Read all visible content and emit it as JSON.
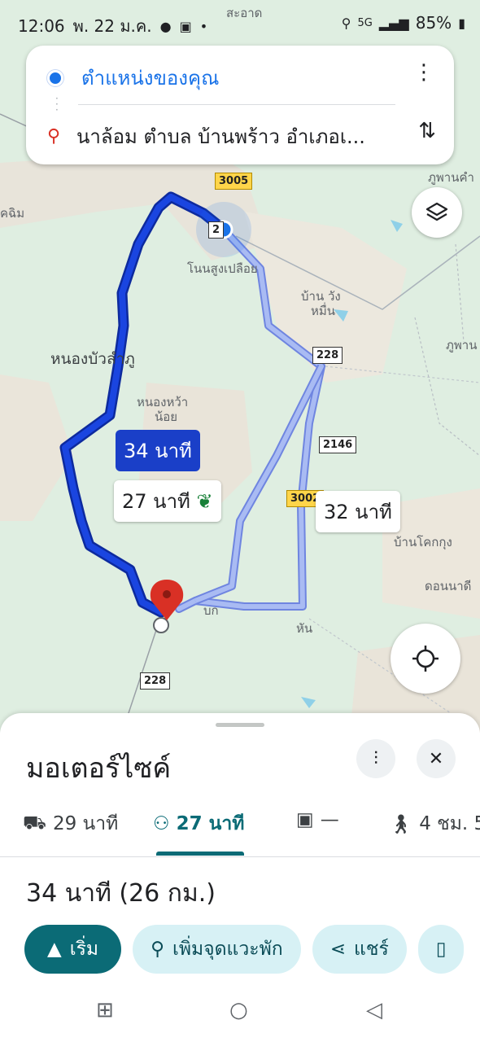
{
  "status_bar": {
    "time": "12:06",
    "date": "พ. 22 ม.ค.",
    "network": "5G",
    "battery": "85%"
  },
  "search_card": {
    "origin": "ตำแหน่งของคุณ",
    "destination": "นาล้อม ตำบล บ้านพร้าว อำเภอเ..."
  },
  "map": {
    "labels": {
      "top_center": "สะอาด",
      "top_right": "ภูพานคำ",
      "left": "คฉิม",
      "nonsung": "โนนสูงเปลือย",
      "banwang_1": "บ้าน วัง",
      "banwang_2": "หมื่น",
      "nongbua": "หนองบัวลำภู",
      "nonghwa_1": "หนองหว้า",
      "nonghwa_2": "น้อย",
      "phuphan": "ภูพาน",
      "bankhok": "บ้านโคกกุง",
      "donnadi": "ดอนนาดี",
      "bok": "บก",
      "han": "หัน"
    },
    "road_shields": {
      "r3005_top": "3005",
      "r2_top": "2",
      "r228_mid": "228",
      "r2146": "2146",
      "r3002": "3002",
      "r228_bottom": "228"
    },
    "route_times": {
      "primary": "34 นาที",
      "alt_eco": "27 นาที",
      "alt_other": "32 นาที"
    }
  },
  "sheet": {
    "title": "มอเตอร์ไซค์",
    "modes": [
      {
        "icon": "car-icon",
        "label": "29 นาที"
      },
      {
        "icon": "motorcycle-icon",
        "label": "27 นาที"
      },
      {
        "icon": "transit-icon",
        "label": "—"
      },
      {
        "icon": "walk-icon",
        "label": "4 ชม. 5"
      }
    ],
    "summary": "34 นาที (26 กม.)",
    "actions": {
      "start": "เริ่ม",
      "add_stop": "เพิ่มจุดแวะพัก",
      "share": "แชร์"
    }
  },
  "colors": {
    "route_primary": "#1a3fc8",
    "route_alt": "#9db0f2",
    "accent_teal": "#0b6b76",
    "pin_red": "#d93025"
  }
}
